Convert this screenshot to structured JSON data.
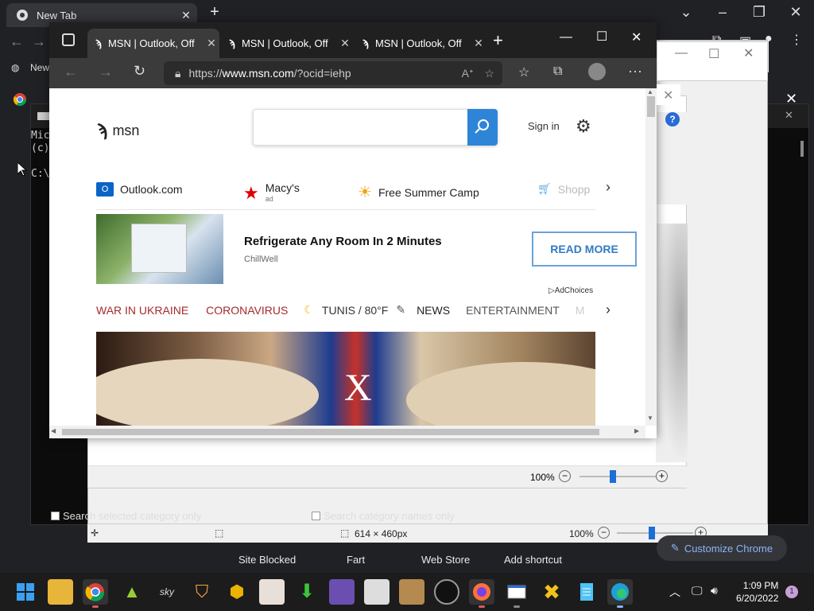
{
  "chrome": {
    "tab_title": "New Tab",
    "bookmark_label": "New",
    "shortcuts": [
      "Site Blocked",
      "Fart",
      "Web Store",
      "Add shortcut"
    ],
    "customize_label": "Customize Chrome"
  },
  "console": {
    "lines": [
      "Mic",
      "(c)",
      "C:\\"
    ]
  },
  "paint": {
    "zoom": "100%",
    "dimensions": "614 × 460px",
    "photos_zoom": "100%"
  },
  "categories": {
    "opt1": "Search selected category only",
    "opt2": "Search category names only"
  },
  "edge": {
    "tabs": [
      {
        "label": "MSN | Outlook, Off"
      },
      {
        "label": "MSN | Outlook, Off"
      },
      {
        "label": "MSN | Outlook, Off"
      }
    ],
    "url_prefix": "https://",
    "url_domain": "www.msn.com",
    "url_path": "/?ocid=iehp"
  },
  "msn": {
    "logo": "msn",
    "sign_in": "Sign in",
    "quicklinks": [
      {
        "label": "Outlook.com"
      },
      {
        "label": "Macy's",
        "sub": "ad"
      },
      {
        "label": "Free Summer Camp"
      },
      {
        "label": "Shopp"
      }
    ],
    "ad": {
      "headline": "Refrigerate Any Room In 2 Minutes",
      "source": "ChillWell",
      "cta": "READ MORE",
      "adchoices": "AdChoices"
    },
    "nav": {
      "items": [
        "WAR IN UKRAINE",
        "CORONAVIRUS",
        "TUNIS / 80°F",
        "NEWS",
        "ENTERTAINMENT",
        "M"
      ]
    },
    "colors": {
      "accent": "#2e85d8",
      "red_nav": "#a52a2a"
    }
  },
  "taskbar": {
    "time": "1:09 PM",
    "date": "6/20/2022",
    "notification_count": "1"
  }
}
